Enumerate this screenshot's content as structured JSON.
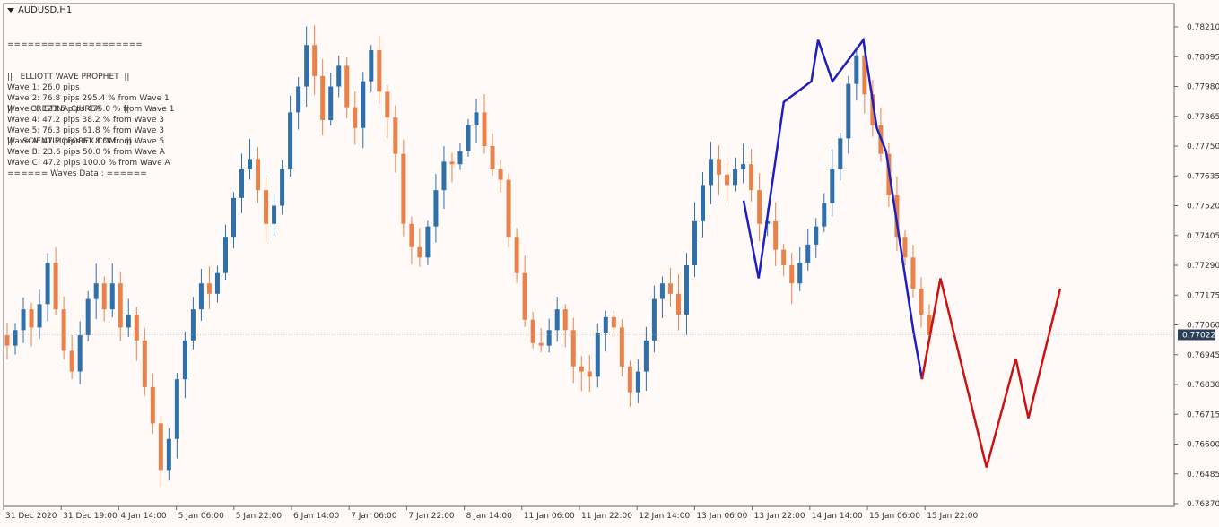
{
  "header": {
    "symbol": "AUDUSD,H1"
  },
  "info": {
    "lines": [
      "====================",
      "||   ELLIOTT WAVE PROPHET  ||",
      "||       CRISTINA CIUREA         ||",
      "||    SCIENTIFICFOREX.COM    ||",
      "====== Waves Data : ======"
    ]
  },
  "waves": [
    "Wave 1: 26.0 pips",
    "Wave 2: 76.8 pips 295.4 % from Wave 1",
    "Wave 3: 123.5 pips 475.0 % from Wave 1",
    "Wave 4: 47.2 pips 38.2 % from Wave 3",
    "Wave 5: 76.3 pips 61.8 % from Wave 3",
    "Wave A: 47.2 pips 61.8 % from Wave 5",
    "Wave B: 23.6 pips 50.0 % from Wave A",
    "Wave C: 47.2 pips 100.0 % from Wave A"
  ],
  "chart_data": {
    "type": "line",
    "y_ticks": [
      "0.78210",
      "0.78095",
      "0.77980",
      "0.77865",
      "0.77750",
      "0.77635",
      "0.77520",
      "0.77405",
      "0.77290",
      "0.77175",
      "0.77060",
      "0.76945",
      "0.76830",
      "0.76715",
      "0.76600",
      "0.76485",
      "0.76370"
    ],
    "ylim": [
      0.7635,
      0.7825
    ],
    "current_price": "0.77022",
    "x_ticks": [
      "31 Dec 2020",
      "31 Dec 19:00",
      "4 Jan 14:00",
      "5 Jan 06:00",
      "5 Jan 22:00",
      "6 Jan 14:00",
      "7 Jan 06:00",
      "7 Jan 22:00",
      "8 Jan 14:00",
      "11 Jan 06:00",
      "11 Jan 22:00",
      "12 Jan 14:00",
      "13 Jan 06:00",
      "13 Jan 22:00",
      "14 Jan 14:00",
      "15 Jan 06:00",
      "15 Jan 22:00"
    ],
    "x_tick_index": [
      0,
      1,
      2,
      3,
      4,
      5,
      6,
      7,
      8,
      9,
      10,
      11,
      12,
      13,
      14,
      15,
      16
    ],
    "close_series": [
      0.7698,
      0.7704,
      0.7712,
      0.7705,
      0.7714,
      0.773,
      0.7712,
      0.7696,
      0.7688,
      0.7702,
      0.7716,
      0.7722,
      0.7712,
      0.7722,
      0.7705,
      0.771,
      0.77,
      0.7682,
      0.7668,
      0.765,
      0.7662,
      0.7685,
      0.77,
      0.7712,
      0.7722,
      0.7718,
      0.7726,
      0.774,
      0.7755,
      0.7766,
      0.777,
      0.7758,
      0.7745,
      0.7752,
      0.7766,
      0.7788,
      0.7798,
      0.7814,
      0.7802,
      0.7785,
      0.7798,
      0.7806,
      0.779,
      0.7782,
      0.78,
      0.7812,
      0.7796,
      0.7786,
      0.7772,
      0.7745,
      0.7736,
      0.7732,
      0.7744,
      0.7758,
      0.7769,
      0.7768,
      0.7773,
      0.7783,
      0.7788,
      0.7775,
      0.7766,
      0.7762,
      0.774,
      0.7726,
      0.7708,
      0.7699,
      0.7698,
      0.7704,
      0.7712,
      0.7704,
      0.769,
      0.7688,
      0.7686,
      0.7703,
      0.7709,
      0.7705,
      0.769,
      0.768,
      0.7688,
      0.77,
      0.7716,
      0.7722,
      0.7718,
      0.771,
      0.7729,
      0.7746,
      0.776,
      0.777,
      0.7764,
      0.776,
      0.7766,
      0.7768,
      0.7758,
      0.7745,
      0.7746,
      0.7735,
      0.7729,
      0.7722,
      0.773,
      0.7737,
      0.7744,
      0.7753,
      0.7766,
      0.7778,
      0.7799,
      0.781,
      0.7795,
      0.7783,
      0.7772,
      0.7756,
      0.774,
      0.7732,
      0.772,
      0.771,
      0.7702
    ],
    "series": [
      {
        "name": "",
        "color": "#1f1fbf",
        "points": [
          [
            0.7762,
            0.7754
          ],
          [
            0.778,
            0.7724
          ],
          [
            0.781,
            0.7792
          ],
          [
            0.7843,
            0.78
          ],
          [
            0.7851,
            0.7816
          ],
          [
            0.7868,
            0.78
          ],
          [
            0.7905,
            0.7816
          ],
          [
            0.7921,
            0.7782
          ],
          [
            0.7932,
            0.7773
          ],
          [
            0.7965,
            0.7703
          ],
          [
            0.7975,
            0.7685
          ]
        ]
      },
      {
        "name": "",
        "color": "#cc1111",
        "points": [
          [
            0.7975,
            0.7685
          ],
          [
            0.7997,
            0.7724
          ],
          [
            0.8052,
            0.7651
          ],
          [
            0.8087,
            0.7693
          ],
          [
            0.8102,
            0.767
          ],
          [
            0.814,
            0.772
          ]
        ]
      }
    ],
    "candle_up_color": "#2f6faa",
    "candle_down_color": "#e8824a",
    "grid": false
  }
}
